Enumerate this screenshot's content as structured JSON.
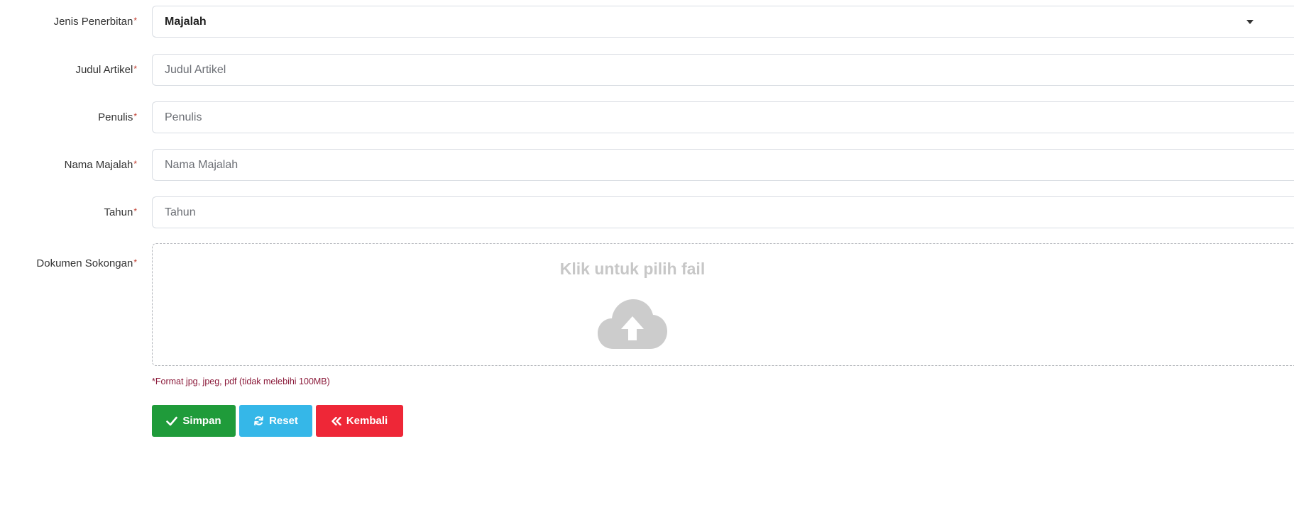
{
  "form": {
    "publication_type": {
      "label": "Jenis Penerbitan",
      "value": "Majalah"
    },
    "article_title": {
      "label": "Judul Artikel",
      "placeholder": "Judul Artikel"
    },
    "author": {
      "label": "Penulis",
      "placeholder": "Penulis"
    },
    "magazine_name": {
      "label": "Nama Majalah",
      "placeholder": "Nama Majalah"
    },
    "year": {
      "label": "Tahun",
      "placeholder": "Tahun"
    },
    "document": {
      "label": "Dokumen Sokongan",
      "dropzone_text": "Klik untuk pilih fail",
      "hint": "*Format jpg, jpeg, pdf (tidak melebihi 100MB)"
    },
    "required_marker": "*"
  },
  "buttons": {
    "save": {
      "label": "Simpan",
      "icon": "check-icon",
      "color": "#1f9b3a"
    },
    "reset": {
      "label": "Reset",
      "icon": "refresh-icon",
      "color": "#35b7e8"
    },
    "back": {
      "label": "Kembali",
      "icon": "double-left-icon",
      "color": "#ee2737"
    }
  }
}
